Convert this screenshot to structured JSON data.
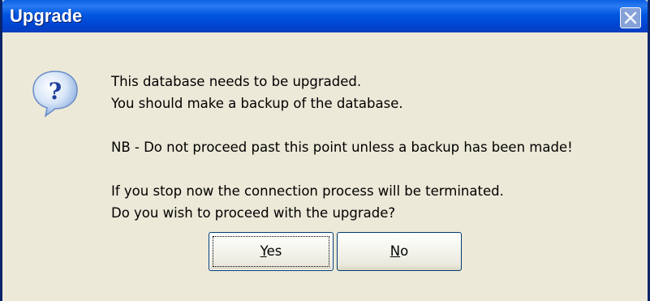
{
  "window": {
    "title": "Upgrade",
    "close_icon": "close-icon"
  },
  "dialog": {
    "icon": "question-icon",
    "lines": [
      "This database needs to be upgraded.",
      "You should make a backup of the database.",
      "",
      "NB - Do not proceed past this point unless a backup has been made!",
      "",
      "If you stop now the connection process will be terminated.",
      "Do you wish to proceed with the upgrade?"
    ]
  },
  "buttons": {
    "yes_rest": "es",
    "yes_mnemonic": "Y",
    "no_rest": "o",
    "no_mnemonic": "N"
  }
}
